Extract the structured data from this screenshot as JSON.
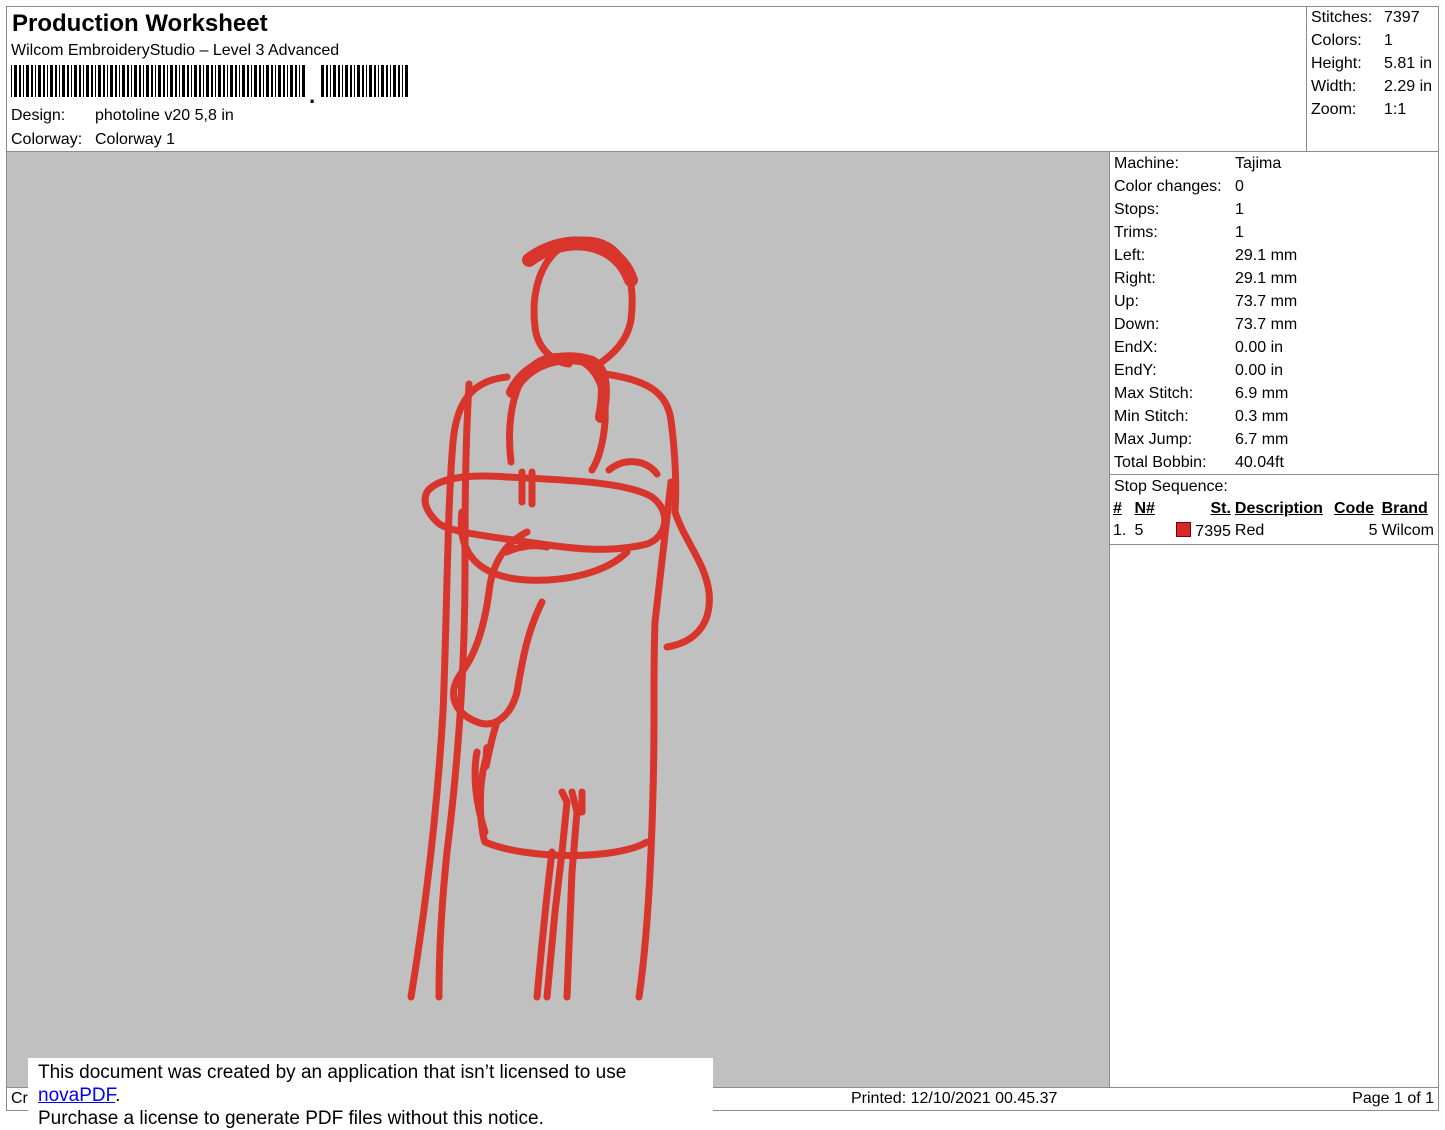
{
  "header": {
    "title": "Production Worksheet",
    "subtitle": "Wilcom EmbroideryStudio – Level 3 Advanced",
    "barcode_separator": ",",
    "design_label": "Design:",
    "design_value": "photoline v20 5,8 in",
    "colorway_label": "Colorway:",
    "colorway_value": "Colorway 1"
  },
  "stats": [
    {
      "label": "Stitches:",
      "value": "7397"
    },
    {
      "label": "Colors:",
      "value": "1"
    },
    {
      "label": "Height:",
      "value": "5.81 in"
    },
    {
      "label": "Width:",
      "value": "2.29 in"
    },
    {
      "label": "Zoom:",
      "value": "1:1"
    }
  ],
  "properties": [
    {
      "label": "Machine:",
      "value": "Tajima"
    },
    {
      "label": "Color changes:",
      "value": "0"
    },
    {
      "label": "Stops:",
      "value": "1"
    },
    {
      "label": "Trims:",
      "value": "1"
    },
    {
      "label": "Left:",
      "value": "29.1 mm"
    },
    {
      "label": "Right:",
      "value": "29.1 mm"
    },
    {
      "label": "Up:",
      "value": "73.7 mm"
    },
    {
      "label": "Down:",
      "value": "73.7 mm"
    },
    {
      "label": "EndX:",
      "value": "0.00 in"
    },
    {
      "label": "EndY:",
      "value": "0.00 in"
    },
    {
      "label": "Max Stitch:",
      "value": "6.9 mm"
    },
    {
      "label": "Min Stitch:",
      "value": "0.3 mm"
    },
    {
      "label": "Max Jump:",
      "value": "6.7 mm"
    },
    {
      "label": "Total Bobbin:",
      "value": "40.04ft"
    }
  ],
  "stop_sequence": {
    "title": "Stop Sequence:",
    "headers": [
      "#",
      "N#",
      "St.",
      "Description",
      "Code",
      "Brand"
    ],
    "rows": [
      {
        "index": "1.",
        "needle": "5",
        "color": "#d42a2a",
        "stitches": "7395",
        "description": "Red",
        "code": "5",
        "brand": "Wilcom"
      }
    ]
  },
  "design_colors": {
    "background": "#c0c0c0",
    "thread": "#d8352d"
  },
  "footer": {
    "left_fragment": "Cr",
    "printed": "Printed: 12/10/2021 00.45.37",
    "page": "Page 1 of 1"
  },
  "notice": {
    "line1_before": "This document was created by an application that isn’t licensed to use ",
    "link": "novaPDF",
    "line1_after": ".",
    "line2": "Purchase a license to generate PDF files without this notice."
  }
}
